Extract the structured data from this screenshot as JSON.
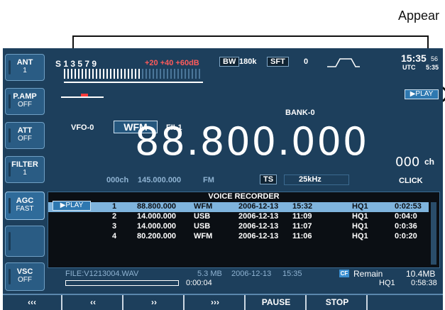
{
  "callout": {
    "label": "Appear"
  },
  "clock": {
    "time": "15:35",
    "time_seconds": "56",
    "utc_label": "UTC",
    "utc_time": "5:35"
  },
  "meter": {
    "scale": "S 1  3  5  7  9",
    "scale_over": "+20  +40  +60dB"
  },
  "bw": {
    "label": "BW",
    "value": "180k"
  },
  "sft": {
    "label": "SFT",
    "value": "0"
  },
  "play_top": "PLAY",
  "play_left": "PLAY",
  "bank": "BANK-0",
  "vfo": "VFO-0",
  "mode": "WFM",
  "filter": "FIL1",
  "frequency": {
    "main": "88.800.000",
    "sub": "000",
    "sub_unit": "ch"
  },
  "info_line": {
    "channel": "000ch",
    "memo_freq": "145.000.000",
    "memo_mode": "FM"
  },
  "ts": {
    "label": "TS",
    "value": "25kHz"
  },
  "click": "CLICK",
  "left_buttons": [
    {
      "label": "ANT",
      "sub": "1"
    },
    {
      "label": "P.AMP",
      "sub": "OFF"
    },
    {
      "label": "ATT",
      "sub": "OFF"
    },
    {
      "label": "FILTER",
      "sub": "1"
    },
    {
      "label": "AGC",
      "sub": "FAST"
    },
    {
      "label": "",
      "sub": ""
    },
    {
      "label": "VSC",
      "sub": "OFF"
    }
  ],
  "voice_recorder": {
    "title": "VOICE RECORDER",
    "rows": [
      {
        "num": "1",
        "freq": "88.800.000",
        "mode": "WFM",
        "date": "2006-12-13",
        "time": "15:32",
        "quality": "HQ1",
        "duration": "0:02:53"
      },
      {
        "num": "2",
        "freq": "14.000.000",
        "mode": "USB",
        "date": "2006-12-13",
        "time": "11:09",
        "quality": "HQ1",
        "duration": "0:04:0"
      },
      {
        "num": "3",
        "freq": "14.000.000",
        "mode": "USB",
        "date": "2006-12-13",
        "time": "11:07",
        "quality": "HQ1",
        "duration": "0:0:36"
      },
      {
        "num": "4",
        "freq": "80.200.000",
        "mode": "WFM",
        "date": "2006-12-13",
        "time": "11:06",
        "quality": "HQ1",
        "duration": "0:0:20"
      }
    ]
  },
  "file_status": {
    "file": "FILE:V1213004.WAV",
    "size": "5.3 MB",
    "date": "2006-12-13",
    "time": "15:35",
    "elapsed": "0:00:04",
    "progress": 0
  },
  "remain": {
    "badge": "CF",
    "label": "Remain",
    "size": "10.4MB",
    "quality": "HQ1",
    "time": "0:58:38"
  },
  "bottom_keys": [
    "‹‹‹",
    "‹‹",
    "››",
    "›››",
    "PAUSE",
    "STOP",
    ""
  ]
}
